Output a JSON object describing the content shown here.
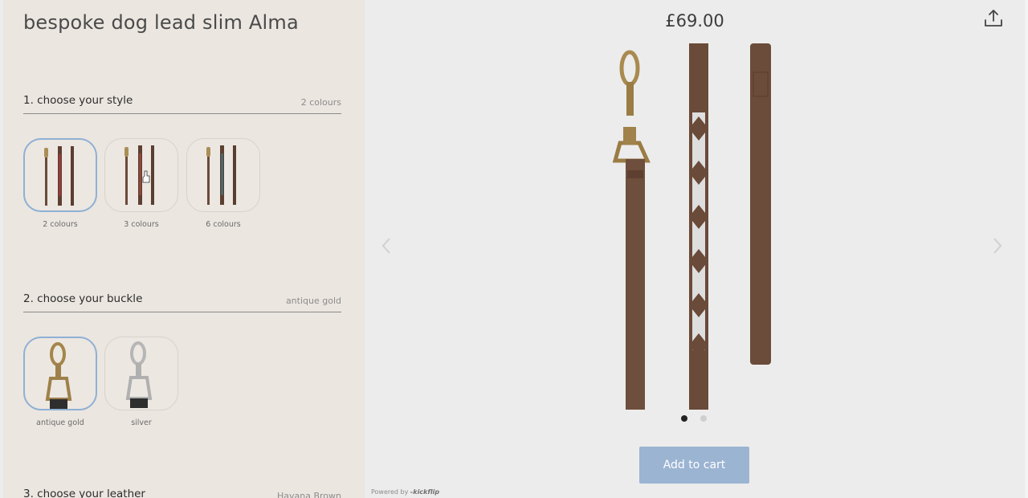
{
  "product": {
    "title": "bespoke dog lead slim Alma",
    "price": "£69.00"
  },
  "sections": [
    {
      "title": "1. choose your style",
      "value": "2 colours",
      "options": [
        {
          "label": "2 colours",
          "selected": true
        },
        {
          "label": "3 colours",
          "selected": false
        },
        {
          "label": "6 colours",
          "selected": false
        }
      ]
    },
    {
      "title": "2. choose your buckle",
      "value": "antique gold",
      "options": [
        {
          "label": "antique gold",
          "selected": true
        },
        {
          "label": "silver",
          "selected": false
        }
      ]
    },
    {
      "title": "3. choose your leather",
      "value": "Havana Brown"
    }
  ],
  "viewer": {
    "active_image": 1,
    "image_count": 2
  },
  "cart": {
    "label": "Add to cart"
  },
  "footer": {
    "powered_prefix": "Powered by",
    "powered_brand": "-kickflip"
  },
  "colors": {
    "accent": "#9bb4d2",
    "leather": "#6b4a3a",
    "selected_border": "#8fb0d4",
    "panel_bg": "#ebe6e0"
  },
  "icons": {
    "share": "share-upload-icon",
    "prev": "chevron-left-icon",
    "next": "chevron-right-icon"
  }
}
